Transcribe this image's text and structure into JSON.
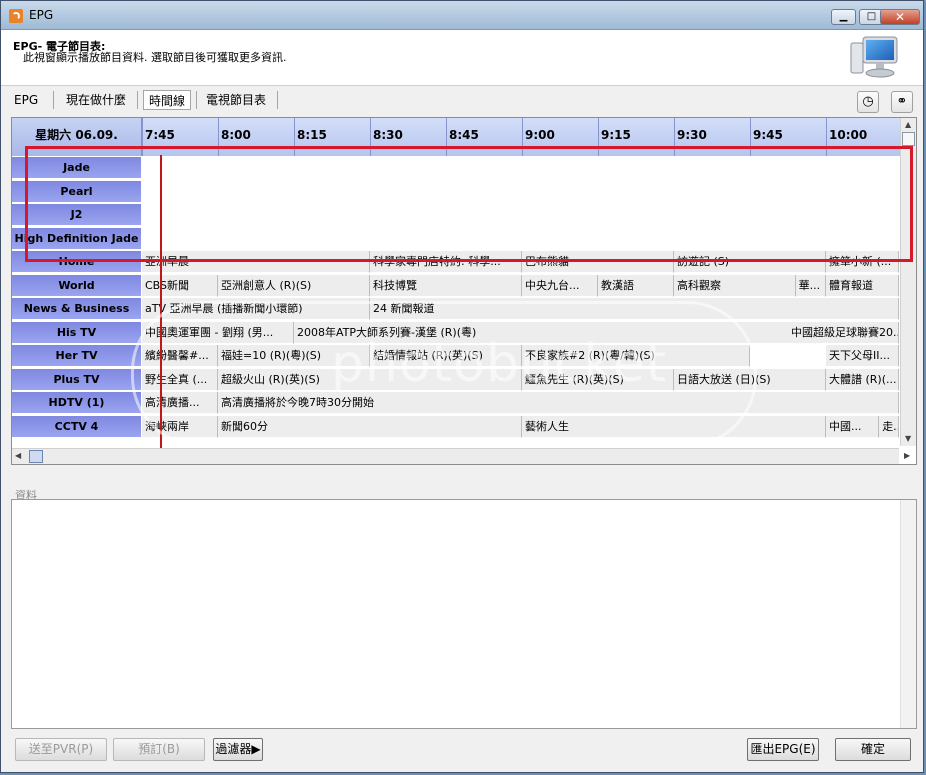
{
  "window": {
    "title": "EPG"
  },
  "header": {
    "title": "EPG- 電子節目表:",
    "description": "此視窗顯示播放節目資料. 選取節目後可獲取更多資訊."
  },
  "tabs": [
    {
      "label": "EPG"
    },
    {
      "label": "現在做什麼"
    },
    {
      "label": "時間線",
      "selected": true
    },
    {
      "label": "電視節目表"
    }
  ],
  "toolbar_icons": [
    "clock-icon",
    "binoculars-icon"
  ],
  "grid": {
    "day": "星期六 06.09.",
    "times": [
      "7:45",
      "8:00",
      "8:15",
      "8:30",
      "8:45",
      "9:00",
      "9:15",
      "9:30",
      "9:45",
      "10:00"
    ],
    "channels": [
      {
        "name": "Jade",
        "programs": []
      },
      {
        "name": "Pearl",
        "programs": []
      },
      {
        "name": "J2",
        "programs": []
      },
      {
        "name": "High Definition Jade",
        "programs": []
      },
      {
        "name": "Home",
        "programs": [
          "亞洲早晨",
          "科學家專門店特約: 科學...",
          "巴布熊貓",
          "訪遊記 (S)",
          "擁箪小新 (..."
        ]
      },
      {
        "name": "World",
        "programs": [
          "CBS新聞",
          "亞洲創意人 (R)(S)",
          "科技博覽",
          "中央九台...",
          "教漢語",
          "高科觀察",
          "華...",
          "體育報道"
        ]
      },
      {
        "name": "News & Business",
        "programs": [
          "aTV 亞洲早晨 (插播新聞小環節)",
          "24 新聞報道"
        ]
      },
      {
        "name": "His TV",
        "programs": [
          "中國奧運軍團 - 劉翔 (男...",
          "2008年ATP大師系列賽-漢堡 (R)(粵)",
          "中國超級足球聯賽20..."
        ]
      },
      {
        "name": "Her TV",
        "programs": [
          "繽紛醫馨#...",
          "福娃=10 (R)(粵)(S)",
          "結婚情報站 (R)(英)(S)",
          "不良家族#2 (R)(粵/韓)(S)",
          "天下父母II..."
        ]
      },
      {
        "name": "Plus TV",
        "programs": [
          "野生全真 (...",
          "超級火山 (R)(英)(S)",
          "鱷魚先生 (R)(英)(S)",
          "日語大放送 (日)(S)",
          "大體譜 (R)(..."
        ]
      },
      {
        "name": "HDTV (1)",
        "programs": [
          "高清廣播...",
          "高清廣播將於今晚7時30分開始"
        ]
      },
      {
        "name": "CCTV 4",
        "programs": [
          "海峽兩岸",
          "新聞60分",
          "藝術人生",
          "中國...",
          "走..."
        ]
      }
    ]
  },
  "info": {
    "label": "資料"
  },
  "buttons": {
    "send_pvr": "送至PVR(P)",
    "schedule": "預訂(B)",
    "filter": "過濾器▶",
    "export": "匯出EPG(E)",
    "ok": "確定"
  },
  "colors": {
    "accent": "#d6182a",
    "channel_bg": "#8a93e8",
    "time_header": "#c2cff3"
  },
  "watermark": "photobucket"
}
